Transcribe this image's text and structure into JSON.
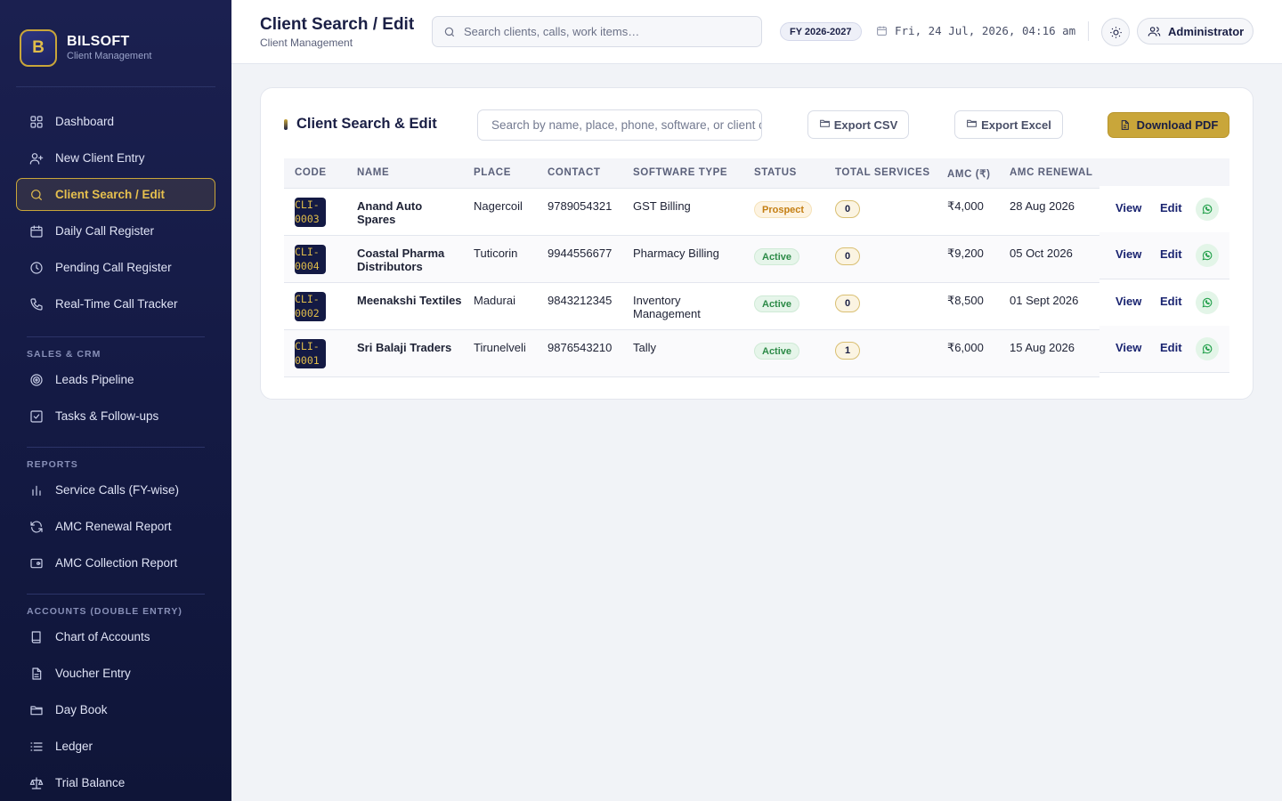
{
  "brand": {
    "logo_letter": "B",
    "name": "BILSOFT",
    "subtitle": "Client Management"
  },
  "sidebar": {
    "main": [
      {
        "label": "Dashboard",
        "icon": "grid-icon"
      },
      {
        "label": "New Client Entry",
        "icon": "user-plus-icon"
      },
      {
        "label": "Client Search / Edit",
        "icon": "search-icon",
        "active": true
      },
      {
        "label": "Daily Call Register",
        "icon": "calendar-icon"
      },
      {
        "label": "Pending Call Register",
        "icon": "clock-icon"
      },
      {
        "label": "Real-Time Call Tracker",
        "icon": "phone-icon"
      }
    ],
    "sales_label": "SALES & CRM",
    "sales": [
      {
        "label": "Leads Pipeline",
        "icon": "target-icon"
      },
      {
        "label": "Tasks & Follow-ups",
        "icon": "checkbox-icon"
      }
    ],
    "reports_label": "REPORTS",
    "reports": [
      {
        "label": "Service Calls (FY-wise)",
        "icon": "bar-chart-icon"
      },
      {
        "label": "AMC Renewal Report",
        "icon": "refresh-icon"
      },
      {
        "label": "AMC Collection Report",
        "icon": "wallet-icon"
      }
    ],
    "accounts_label": "ACCOUNTS (DOUBLE ENTRY)",
    "accounts": [
      {
        "label": "Chart of Accounts",
        "icon": "book-icon"
      },
      {
        "label": "Voucher Entry",
        "icon": "file-icon"
      },
      {
        "label": "Day Book",
        "icon": "folder-icon"
      },
      {
        "label": "Ledger",
        "icon": "list-icon"
      },
      {
        "label": "Trial Balance",
        "icon": "scale-icon"
      }
    ]
  },
  "header": {
    "title": "Client Search / Edit",
    "subtitle": "Client Management",
    "search_placeholder": "Search clients, calls, work items…",
    "fy_badge": "FY 2026-2027",
    "datetime": "Fri, 24 Jul, 2026, 04:16 am",
    "user": "Administrator"
  },
  "card": {
    "title": "Client Search & Edit",
    "search_placeholder": "Search by name, place, phone, software, or client code",
    "export_csv": "Export CSV",
    "export_excel": "Export Excel",
    "download_pdf": "Download PDF"
  },
  "table": {
    "columns": [
      "CODE",
      "NAME",
      "PLACE",
      "CONTACT",
      "SOFTWARE TYPE",
      "STATUS",
      "TOTAL SERVICES",
      "AMC (₹)",
      "AMC RENEWAL"
    ],
    "rows": [
      {
        "code_1": "CLI-",
        "code_2": "0003",
        "name": "Anand Auto Spares",
        "place": "Nagercoil",
        "contact": "9789054321",
        "software": "GST Billing",
        "status": "Prospect",
        "services": "0",
        "amc": "₹4,000",
        "renewal": "28 Aug 2026"
      },
      {
        "code_1": "CLI-",
        "code_2": "0004",
        "name": "Coastal Pharma Distributors",
        "place": "Tuticorin",
        "contact": "9944556677",
        "software": "Pharmacy Billing",
        "status": "Active",
        "services": "0",
        "amc": "₹9,200",
        "renewal": "05 Oct 2026"
      },
      {
        "code_1": "CLI-",
        "code_2": "0002",
        "name": "Meenakshi Textiles",
        "place": "Madurai",
        "contact": "9843212345",
        "software": "Inventory Management",
        "status": "Active",
        "services": "0",
        "amc": "₹8,500",
        "renewal": "01 Sept 2026"
      },
      {
        "code_1": "CLI-",
        "code_2": "0001",
        "name": "Sri Balaji Traders",
        "place": "Tirunelveli",
        "contact": "9876543210",
        "software": "Tally",
        "status": "Active",
        "services": "1",
        "amc": "₹6,000",
        "renewal": "15 Aug 2026"
      }
    ],
    "action_view": "View",
    "action_edit": "Edit"
  },
  "colors": {
    "sidebar_bg": "#141a44",
    "accent_gold": "#c9a63a",
    "active_green": "#2c8a47",
    "prospect_orange": "#c47e12"
  }
}
